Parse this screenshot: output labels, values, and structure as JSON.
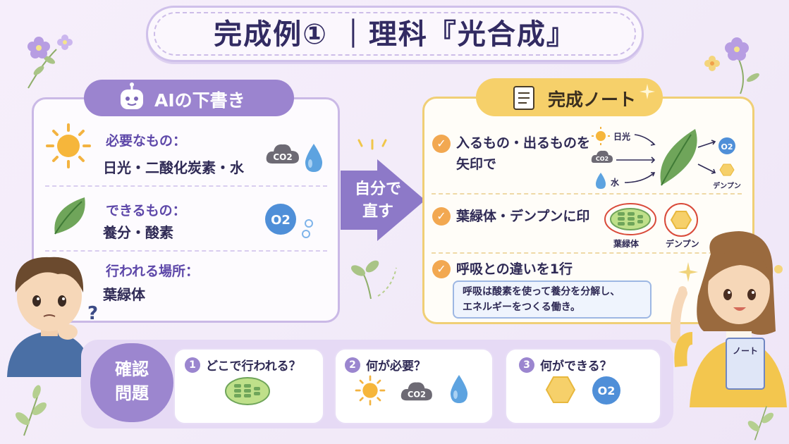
{
  "title": "完成例① ｜理科『光合成』",
  "left_panel": {
    "tab_label": "AIの下書き",
    "rows": [
      {
        "label": "必要なもの：",
        "value": "日光・二酸化炭素・水"
      },
      {
        "label": "できるもの：",
        "value": "養分・酸素"
      },
      {
        "label": "行われる場所：",
        "value": "葉緑体"
      }
    ]
  },
  "arrow": {
    "line1": "自分で",
    "line2": "直す"
  },
  "right_panel": {
    "tab_label": "完成ノート",
    "items": [
      {
        "line1": "入るもの・出るものを",
        "line2": "矢印で"
      },
      {
        "line1": "葉緑体・デンプンに印"
      },
      {
        "line1": "呼吸との違いを1行"
      }
    ],
    "diagram": {
      "sun_label": "日光",
      "water_label": "水",
      "co2_label": "CO2",
      "o2_label": "O2",
      "starch_label": "デンプン"
    },
    "mark_labels": {
      "chloroplast": "葉緑体",
      "starch": "デンプン"
    },
    "note_line1": "呼吸は酸素を使って養分を分解し、",
    "note_line2": "エネルギーをつくる働き。"
  },
  "quiz": {
    "badge_line1": "確認",
    "badge_line2": "問題",
    "cards": [
      {
        "number": "1",
        "text": "どこで行われる？"
      },
      {
        "number": "2",
        "text": "何が必要？"
      },
      {
        "number": "3",
        "text": "何ができる？"
      }
    ]
  },
  "girl_notebook_label": "ノート",
  "colors": {
    "purple": "#9b84cf",
    "yellow": "#f6d06a",
    "navy": "#2f2a55",
    "orange": "#f2a851"
  }
}
